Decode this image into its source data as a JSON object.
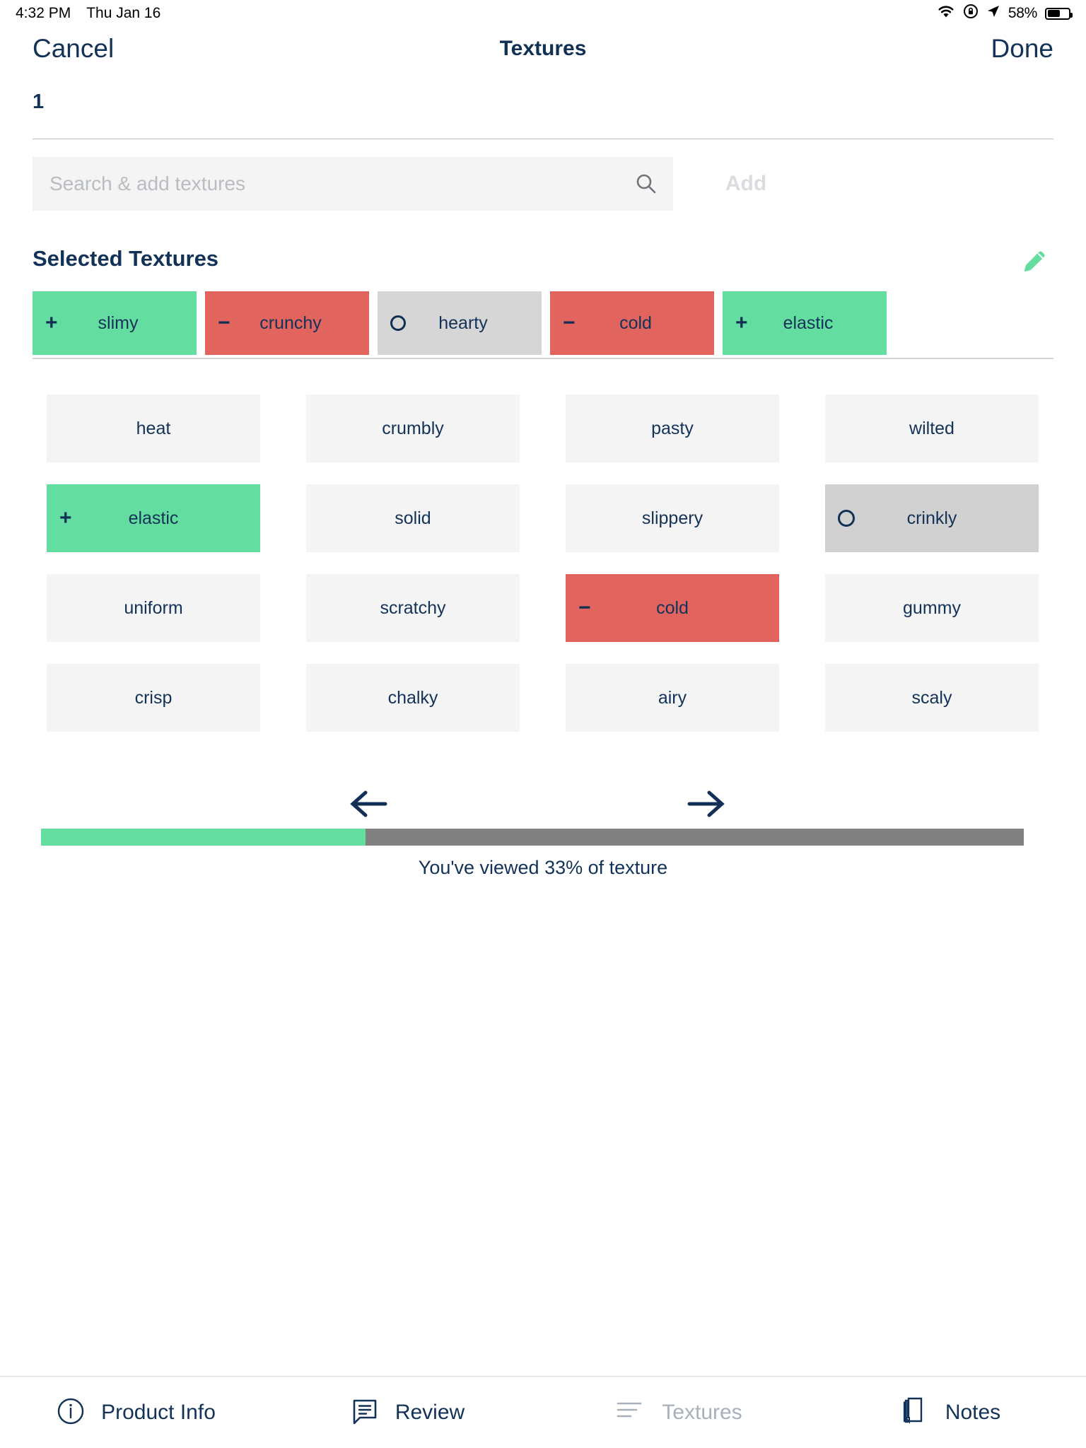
{
  "status_bar": {
    "time": "4:32 PM",
    "date": "Thu Jan 16",
    "battery_percent": "58%",
    "icons": [
      "wifi-icon",
      "rotation-lock-icon",
      "location-arrow-icon",
      "battery-icon"
    ]
  },
  "nav": {
    "cancel_label": "Cancel",
    "title": "Textures",
    "done_label": "Done"
  },
  "count_badge": "1",
  "search": {
    "placeholder": "Search & add textures",
    "value": "",
    "add_label": "Add"
  },
  "selected_section": {
    "title": "Selected Textures",
    "edit_icon": "pencil-icon",
    "chips": [
      {
        "label": "slimy",
        "state": "pos",
        "sign": "+"
      },
      {
        "label": "crunchy",
        "state": "neg",
        "sign": "−"
      },
      {
        "label": "hearty",
        "state": "neu",
        "sign": "ring"
      },
      {
        "label": "cold",
        "state": "neg",
        "sign": "−"
      },
      {
        "label": "elastic",
        "state": "pos",
        "sign": "+"
      }
    ]
  },
  "grid": {
    "columns": 4,
    "cells": [
      {
        "label": "heat",
        "state": "none",
        "sign": ""
      },
      {
        "label": "crumbly",
        "state": "none",
        "sign": ""
      },
      {
        "label": "pasty",
        "state": "none",
        "sign": ""
      },
      {
        "label": "wilted",
        "state": "none",
        "sign": ""
      },
      {
        "label": "elastic",
        "state": "pos",
        "sign": "+"
      },
      {
        "label": "solid",
        "state": "none",
        "sign": ""
      },
      {
        "label": "slippery",
        "state": "none",
        "sign": ""
      },
      {
        "label": "crinkly",
        "state": "neu",
        "sign": "ring"
      },
      {
        "label": "uniform",
        "state": "none",
        "sign": ""
      },
      {
        "label": "scratchy",
        "state": "none",
        "sign": ""
      },
      {
        "label": "cold",
        "state": "neg",
        "sign": "−"
      },
      {
        "label": "gummy",
        "state": "none",
        "sign": ""
      },
      {
        "label": "crisp",
        "state": "none",
        "sign": ""
      },
      {
        "label": "chalky",
        "state": "none",
        "sign": ""
      },
      {
        "label": "airy",
        "state": "none",
        "sign": ""
      },
      {
        "label": "scaly",
        "state": "none",
        "sign": ""
      }
    ]
  },
  "pager": {
    "prev_icon": "arrow-left-icon",
    "next_icon": "arrow-right-icon"
  },
  "progress": {
    "percent": 33,
    "label": "You've viewed 33% of texture"
  },
  "tabs": [
    {
      "label": "Product Info",
      "icon": "info-circle-icon",
      "active": true
    },
    {
      "label": "Review",
      "icon": "comment-lines-icon",
      "active": true
    },
    {
      "label": "Textures",
      "icon": "list-lines-icon",
      "active": false
    },
    {
      "label": "Notes",
      "icon": "notes-pages-icon",
      "active": true
    }
  ],
  "colors": {
    "positive": "#64dda1",
    "negative": "#e2645f",
    "neutral": "#d6d6d6",
    "accent_text": "#133258",
    "muted": "#a7b0bb"
  }
}
